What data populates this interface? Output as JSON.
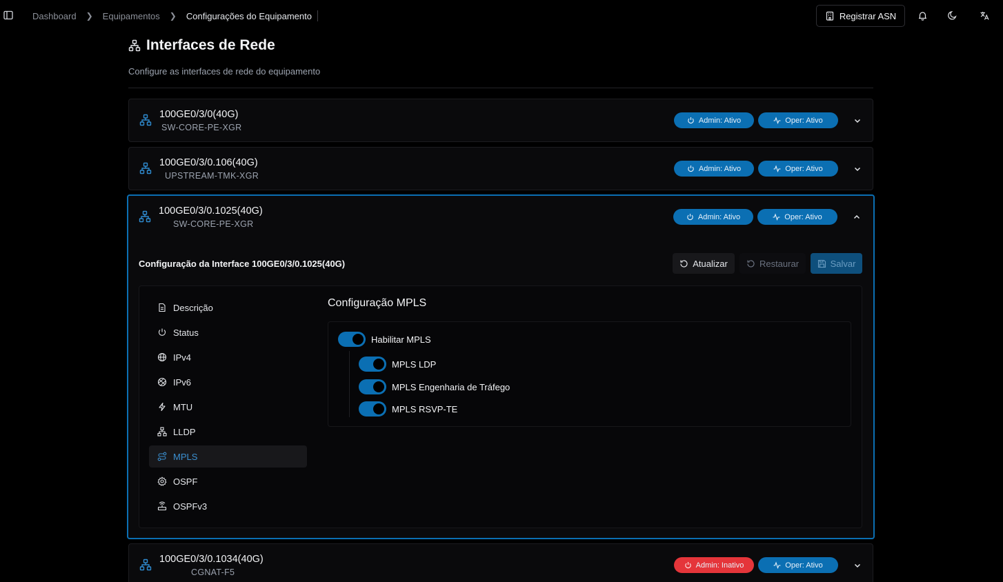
{
  "breadcrumb": [
    "Dashboard",
    "Equipamentos",
    "Configurações do Equipamento"
  ],
  "header": {
    "register_asn": "Registrar ASN"
  },
  "page": {
    "title": "Interfaces de Rede",
    "subtitle": "Configure as interfaces de rede do equipamento"
  },
  "interfaces": [
    {
      "name": "100GE0/3/0(40G)",
      "description": "SW-CORE-PE-XGR",
      "admin": "Admin: Ativo",
      "oper": "Oper: Ativo",
      "admin_status": "active",
      "expanded": false
    },
    {
      "name": "100GE0/3/0.106(40G)",
      "description": "UPSTREAM-TMK-XGR",
      "admin": "Admin: Ativo",
      "oper": "Oper: Ativo",
      "admin_status": "active",
      "expanded": false
    },
    {
      "name": "100GE0/3/0.1025(40G)",
      "description": "SW-CORE-PE-XGR",
      "admin": "Admin: Ativo",
      "oper": "Oper: Ativo",
      "admin_status": "active",
      "expanded": true
    },
    {
      "name": "100GE0/3/0.1034(40G)",
      "description": "CGNAT-F5",
      "admin": "Admin: Inativo",
      "oper": "Oper: Ativo",
      "admin_status": "inactive",
      "expanded": false
    }
  ],
  "config": {
    "title": "Configuração da Interface 100GE0/3/0.1025(40G)",
    "actions": {
      "refresh": "Atualizar",
      "restore": "Restaurar",
      "save": "Salvar"
    },
    "menu": [
      {
        "label": "Descrição",
        "icon": "file-text-icon"
      },
      {
        "label": "Status",
        "icon": "power-icon"
      },
      {
        "label": "IPv4",
        "icon": "globe-icon"
      },
      {
        "label": "IPv6",
        "icon": "globe-grid-icon"
      },
      {
        "label": "MTU",
        "icon": "bolt-icon"
      },
      {
        "label": "LLDP",
        "icon": "network-icon"
      },
      {
        "label": "MPLS",
        "icon": "route-icon",
        "active": true
      },
      {
        "label": "OSPF",
        "icon": "gear-icon"
      },
      {
        "label": "OSPFv3",
        "icon": "router-icon"
      }
    ],
    "section_title": "Configuração MPLS",
    "toggles": {
      "enable_mpls": {
        "label": "Habilitar MPLS",
        "on": true
      },
      "ldp": {
        "label": "MPLS LDP",
        "on": true
      },
      "te": {
        "label": "MPLS Engenharia de Tráfego",
        "on": true
      },
      "rsvp": {
        "label": "MPLS RSVP-TE",
        "on": true
      }
    }
  },
  "colors": {
    "accent": "#0b6fb3",
    "danger": "#e5353a",
    "background": "#000000"
  }
}
